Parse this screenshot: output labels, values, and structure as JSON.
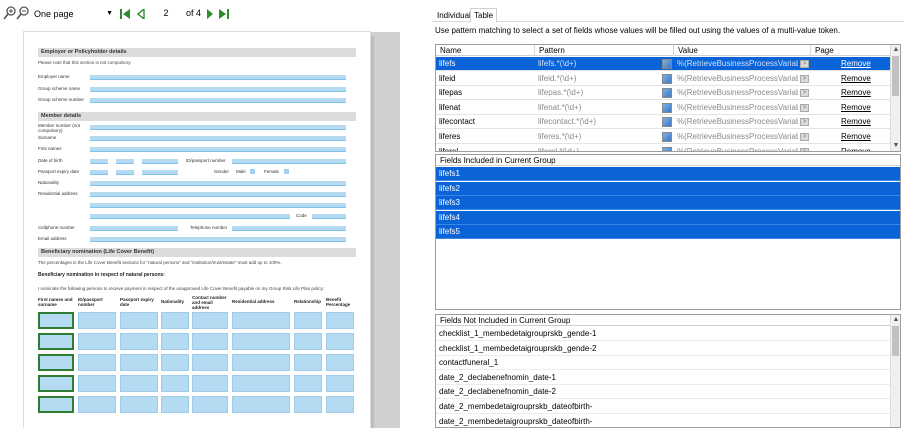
{
  "viewer": {
    "zoom_value": "One page",
    "current_page": "2",
    "page_total": "of 4",
    "document": {
      "employer_section": "Employer or Policyholder details",
      "employer_note": "Please note that this section is not compulsory.",
      "employer_fields": [
        "Employer name",
        "Group scheme name",
        "Group scheme number"
      ],
      "member_section": "Member details",
      "member_fields": [
        "Member number (not compulsory)",
        "Surname",
        "First names",
        "Date of birth",
        "Passport expiry date",
        "Nationality",
        "Residential address",
        "Cellphone number",
        "Email address"
      ],
      "id_label": "ID/passport number",
      "gender_label": "Gender",
      "male_label": "Male",
      "female_label": "Female",
      "code_label": "Code",
      "telephone_label": "Telephone number",
      "beneficiary_section": "Beneficiary nomination (Life Cover Benefit)",
      "beneficiary_note": "The percentages in the Life Cover Benefit sections for \"natural persons\" and \"institution/trust/estate\" must add up to 100%.",
      "natural_heading": "Beneficiary nomination in respect of natural persons:",
      "nominate_text": "I nominate the following persons to receive payment in respect of the unapproved Life Cover Benefit payable on my Group Risk Life Plan policy:",
      "table_headers": [
        "First names and surname",
        "ID/passport number",
        "Passport expiry date",
        "Nationality",
        "Contact number and email address",
        "Residential address",
        "Relationship",
        "Benefit Percentage"
      ]
    }
  },
  "panel": {
    "tabs": [
      "Individual",
      "Table"
    ],
    "active_tab": "Table",
    "description": "Use pattern matching to select a set of fields whose values will be filled out using the values of a multi-value token.",
    "grid_headers": [
      "Name",
      "Pattern",
      "Value",
      "Page"
    ],
    "rows": [
      {
        "name": "lifefs",
        "pattern": "lifefs.*(\\d+)",
        "value": "%(RetrieveBusinessProcessVariables...",
        "action": "Remove"
      },
      {
        "name": "lifeid",
        "pattern": "lifeid.*(\\d+)",
        "value": "%(RetrieveBusinessProcessVariables...",
        "action": "Remove"
      },
      {
        "name": "lifepas",
        "pattern": "lifepas.*(\\d+)",
        "value": "%(RetrieveBusinessProcessVariables...",
        "action": "Remove"
      },
      {
        "name": "lifenat",
        "pattern": "lifenat.*(\\d+)",
        "value": "%(RetrieveBusinessProcessVariables...",
        "action": "Remove"
      },
      {
        "name": "lifecontact",
        "pattern": "lifecontact.*(\\d+)",
        "value": "%(RetrieveBusinessProcessVariables...",
        "action": "Remove"
      },
      {
        "name": "liferes",
        "pattern": "liferes.*(\\d+)",
        "value": "%(RetrieveBusinessProcessVariables...",
        "action": "Remove"
      },
      {
        "name": "liferel",
        "pattern": "liferel.*(\\d+)",
        "value": "%(RetrieveBusinessProcessVariables...",
        "action": "Remove"
      }
    ],
    "included_header": "Fields Included in Current Group",
    "included": [
      "lifefs1",
      "lifefs2",
      "lifefs3",
      "lifefs4",
      "lifefs5"
    ],
    "excluded_header": "Fields Not Included in Current Group",
    "excluded": [
      "checklist_1_membedetaigrouprskb_gende-1",
      "checklist_1_membedetaigrouprskb_gende-2",
      "contactfuneral_1",
      "date_2_declabenefnomin_date-1",
      "date_2_declabenefnomin_date-2",
      "date_2_membedetaigrouprskb_dateofbirth-",
      "date_2_membedetaigrouprskb_dateofbirth-"
    ]
  },
  "colors": {
    "selection": "#0a64d8",
    "field_fill": "#b4dbf2",
    "first_column_border": "#2e7d32"
  }
}
